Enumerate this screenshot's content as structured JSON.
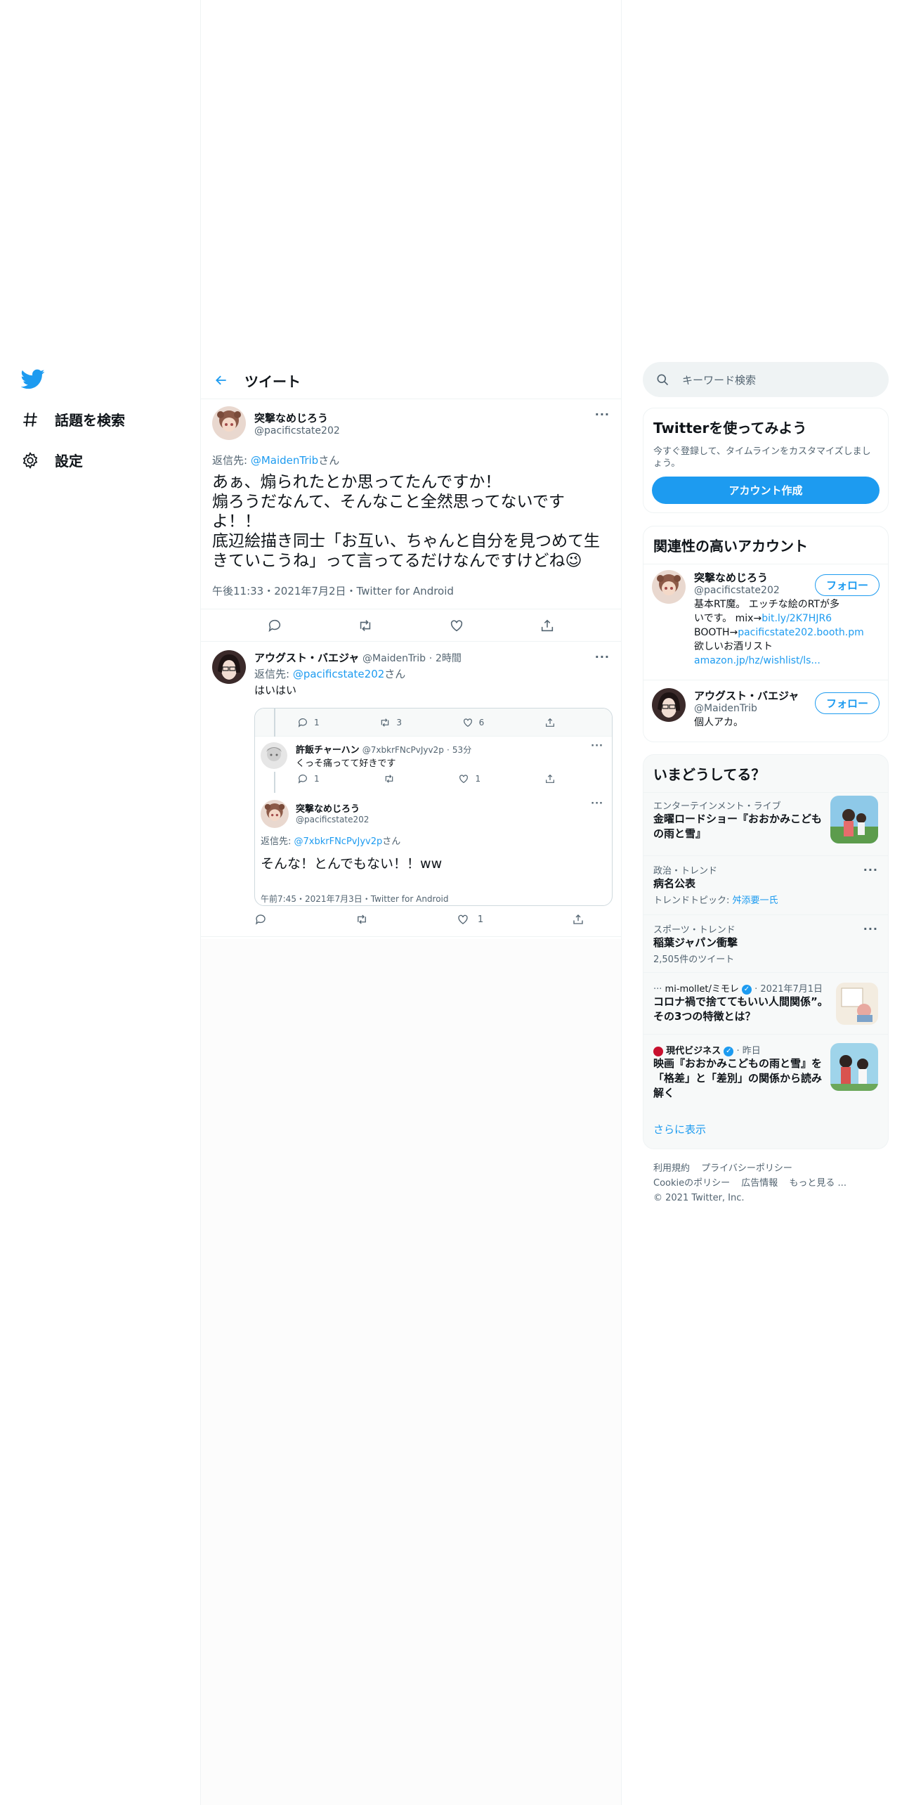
{
  "nav": {
    "explore_label": "話題を検索",
    "settings_label": "設定"
  },
  "header": {
    "title": "ツイート"
  },
  "focal_tweet": {
    "author_name": "突撃なめじろう",
    "author_handle": "@pacificstate202",
    "reply_prefix": "返信先: ",
    "reply_mention": "@MaidenTrib",
    "reply_suffix": "さん",
    "text_lines": [
      "あぁ、煽られたとか思ってたんですか！",
      "煽ろうだなんて、そんなこと全然思ってないです",
      "よ！！",
      "底辺絵描き同士「お互い、ちゃんと自分を見つめて生",
      "きていこうね」って言ってるだけなんですけどね😉"
    ],
    "meta": "午後11:33・2021年7月2日・Twitter for Android"
  },
  "reply_tweet": {
    "author_name": "アウグスト・バエジャ",
    "author_handle": "@MaidenTrib",
    "time": "2時間",
    "reply_prefix": "返信先: ",
    "reply_mention": "@pacificstate202",
    "reply_suffix": "さん",
    "text": "はいはい",
    "like_count": "1",
    "quote": {
      "top_counts": {
        "reply": "1",
        "retweet": "3",
        "like": "6"
      },
      "sub": {
        "author_name": "許飯チャーハン",
        "author_handle": "@7xbkrFNcPvJyv2p",
        "time": "53分",
        "text": "くっそ痛ってて好きです",
        "reply_count": "1",
        "like_count": "1"
      },
      "main": {
        "author_name": "突撃なめじろう",
        "author_handle": "@pacificstate202",
        "reply_prefix": "返信先: ",
        "reply_mention": "@7xbkrFNcPvJyv2p",
        "reply_suffix": "さん",
        "text": "そんな！とんでもない！！ww",
        "meta": "午前7:45・2021年7月3日・Twitter for Android"
      }
    }
  },
  "sidebar": {
    "search_placeholder": "キーワード検索",
    "try_card": {
      "title": "Twitterを使ってみよう",
      "desc": "今すぐ登録して、タイムラインをカスタマイズしましょう。",
      "signup_label": "アカウント作成"
    },
    "relevant": {
      "title": "関連性の高いアカウント",
      "follow_label": "フォロー",
      "accounts": [
        {
          "name": "突撃なめじろう",
          "handle": "@pacificstate202",
          "bio_1": "基本RT魔。 エッチな絵のRTが多いです。 mix→",
          "link_1": "bit.ly/2K7HJR6",
          "bio_2": "BOOTH→",
          "link_2": "pacificstate202.booth.pm",
          "bio_3": " 欲しいお酒リスト",
          "link_3": "amazon.jp/hz/wishlist/ls..."
        },
        {
          "name": "アウグスト・バエジャ",
          "handle": "@MaidenTrib",
          "bio": "個人アカ。"
        }
      ]
    },
    "trends": {
      "title": "いまどうしてる？",
      "items": [
        {
          "category": "エンターテインメント・ライブ",
          "title": "金曜ロードショー『おおかみこどもの雨と雪』"
        },
        {
          "category": "政治・トレンド",
          "title": "病名公表",
          "topic_prefix": "トレンドトピック: ",
          "topic_link": "舛添要一氏"
        },
        {
          "category": "スポーツ・トレンド",
          "title": "稲葉ジャパン衝撃",
          "count": "2,505件のツイート"
        },
        {
          "source": "mi-mollet/ミモレ",
          "date": "2021年7月1日",
          "title": "コロナ禍で捨ててもいい人間関係”。その3つの特徴とは？"
        },
        {
          "source": "現代ビジネス",
          "date": "昨日",
          "title": "映画『おおかみこどもの雨と雪』を「格差」と「差別」の関係から読み解く"
        }
      ],
      "show_more": "さらに表示"
    },
    "footer": {
      "terms": "利用規約",
      "privacy": "プライバシーポリシー",
      "cookie": "Cookieのポリシー",
      "ads": "広告情報",
      "more": "もっと見る ...",
      "copyright": "© 2021 Twitter, Inc."
    }
  },
  "colors": {
    "accent": "#1d9bf0",
    "text": "#0f1419",
    "muted": "#536471",
    "border": "#eff3f4"
  }
}
